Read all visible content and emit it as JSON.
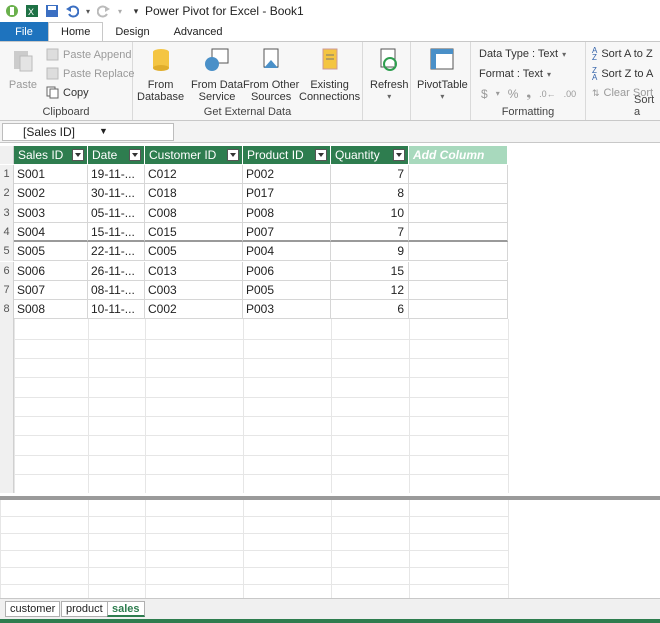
{
  "window": {
    "title": "Power Pivot for Excel - Book1"
  },
  "tabs": [
    "File",
    "Home",
    "Design",
    "Advanced"
  ],
  "ribbon": {
    "clipboard": {
      "paste": "Paste",
      "paste_append": "Paste Append",
      "paste_replace": "Paste Replace",
      "copy": "Copy",
      "label": "Clipboard"
    },
    "external": {
      "from_database": "From\nDatabase",
      "from_data_service": "From Data\nService",
      "from_other": "From Other\nSources",
      "existing": "Existing\nConnections",
      "label": "Get External Data"
    },
    "refresh": "Refresh",
    "pivottable": "PivotTable",
    "formatting": {
      "data_type": "Data Type : Text",
      "format": "Format : Text",
      "label": "Formatting"
    },
    "sort": {
      "a_to_z": "Sort A to Z",
      "z_to_a": "Sort Z to A",
      "clear": "Clear Sort",
      "label": "Sort a"
    }
  },
  "namebox": {
    "value": "[Sales ID]"
  },
  "table": {
    "columns": [
      "Sales ID",
      "Date",
      "Customer ID",
      "Product ID",
      "Quantity"
    ],
    "add_column": "Add Column",
    "rows": [
      [
        "S001",
        "19-11-...",
        "C012",
        "P002",
        "7"
      ],
      [
        "S002",
        "30-11-...",
        "C018",
        "P017",
        "8"
      ],
      [
        "S003",
        "05-11-...",
        "C008",
        "P008",
        "10"
      ],
      [
        "S004",
        "15-11-...",
        "C015",
        "P007",
        "7"
      ],
      [
        "S005",
        "22-11-...",
        "C005",
        "P004",
        "9"
      ],
      [
        "S006",
        "26-11-...",
        "C013",
        "P006",
        "15"
      ],
      [
        "S007",
        "08-11-...",
        "C003",
        "P005",
        "12"
      ],
      [
        "S008",
        "10-11-...",
        "C002",
        "P003",
        "6"
      ]
    ],
    "row_numbers": [
      "1",
      "2",
      "3",
      "4",
      "5",
      "6",
      "7",
      "8"
    ]
  },
  "sheets": [
    "customer",
    "product",
    "sales"
  ],
  "colors": {
    "header_green": "#2e7d4f",
    "file_blue": "#1e73be"
  }
}
